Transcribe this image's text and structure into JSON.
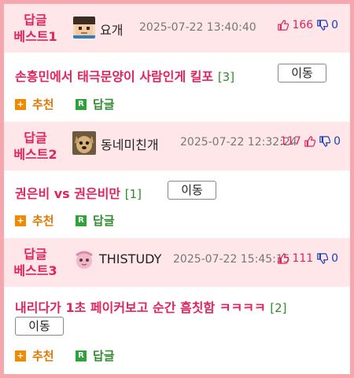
{
  "posts": [
    {
      "best_line1": "답글",
      "best_line2": "베스트1",
      "user": "요개",
      "date": "2025-07-22 13:40:40",
      "up": "166",
      "down": "0",
      "title": "손흥민에서 태극문양이 사람인게 킬포",
      "comments": "[3]",
      "move_label": "이동",
      "recommend_label": "추천",
      "reply_label": "답글"
    },
    {
      "best_line1": "답글",
      "best_line2": "베스트2",
      "user": "동네미친개",
      "date": "2025-07-22 12:32:24",
      "up": "117",
      "down": "0",
      "title": "권은비 vs 권은비만",
      "comments": "[1]",
      "move_label": "이동",
      "recommend_label": "추천",
      "reply_label": "답글"
    },
    {
      "best_line1": "답글",
      "best_line2": "베스트3",
      "user": "THISTUDY",
      "date": "2025-07-22 15:45:15",
      "up": "111",
      "down": "0",
      "title": "내리다가 1초 페이커보고 순간 흠칫함 ㅋㅋㅋㅋ",
      "comments": "[2]",
      "move_label": "이동",
      "recommend_label": "추천",
      "reply_label": "답글"
    }
  ],
  "colors": {
    "border": "#f6a7ad",
    "header_bg": "#ffe6e9",
    "accent": "#e0245e",
    "comment": "#2e8b2e",
    "down": "#1a3fb8"
  },
  "icons": [
    "avatar",
    "thumbs-up-icon",
    "thumbs-down-icon",
    "plus-icon",
    "reply-icon"
  ]
}
